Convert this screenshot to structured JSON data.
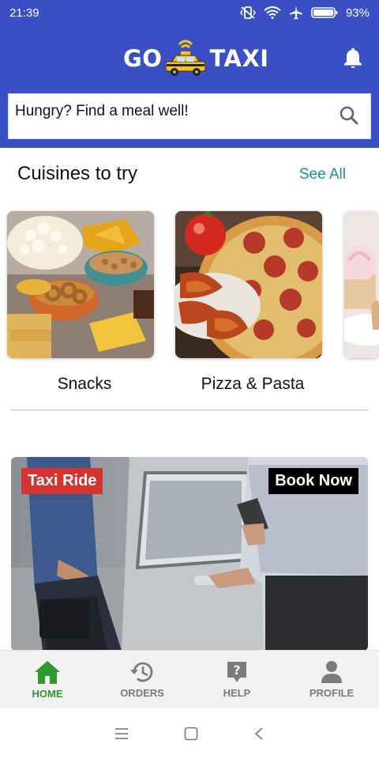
{
  "status_bar": {
    "time": "21:39",
    "battery": "93%"
  },
  "header": {
    "logo_left": "GO",
    "logo_right": "TAXI",
    "bell_icon": "bell-icon",
    "brand_color": "#3a4fc4"
  },
  "search": {
    "placeholder": "Hungry? Find a meal well!"
  },
  "cuisines": {
    "title": "Cuisines to try",
    "see_all": "See All",
    "items": [
      {
        "label": "Snacks"
      },
      {
        "label": "Pizza & Pasta"
      },
      {
        "label": ""
      }
    ]
  },
  "banner": {
    "badge_left": "Taxi Ride",
    "badge_right": "Book Now"
  },
  "bottom_nav": {
    "items": [
      {
        "label": "HOME",
        "icon": "home-icon",
        "active": true
      },
      {
        "label": "ORDERS",
        "icon": "history-icon",
        "active": false
      },
      {
        "label": "HELP",
        "icon": "help-icon",
        "active": false
      },
      {
        "label": "PROFILE",
        "icon": "profile-icon",
        "active": false
      }
    ],
    "active_color": "#2e9a2e"
  }
}
